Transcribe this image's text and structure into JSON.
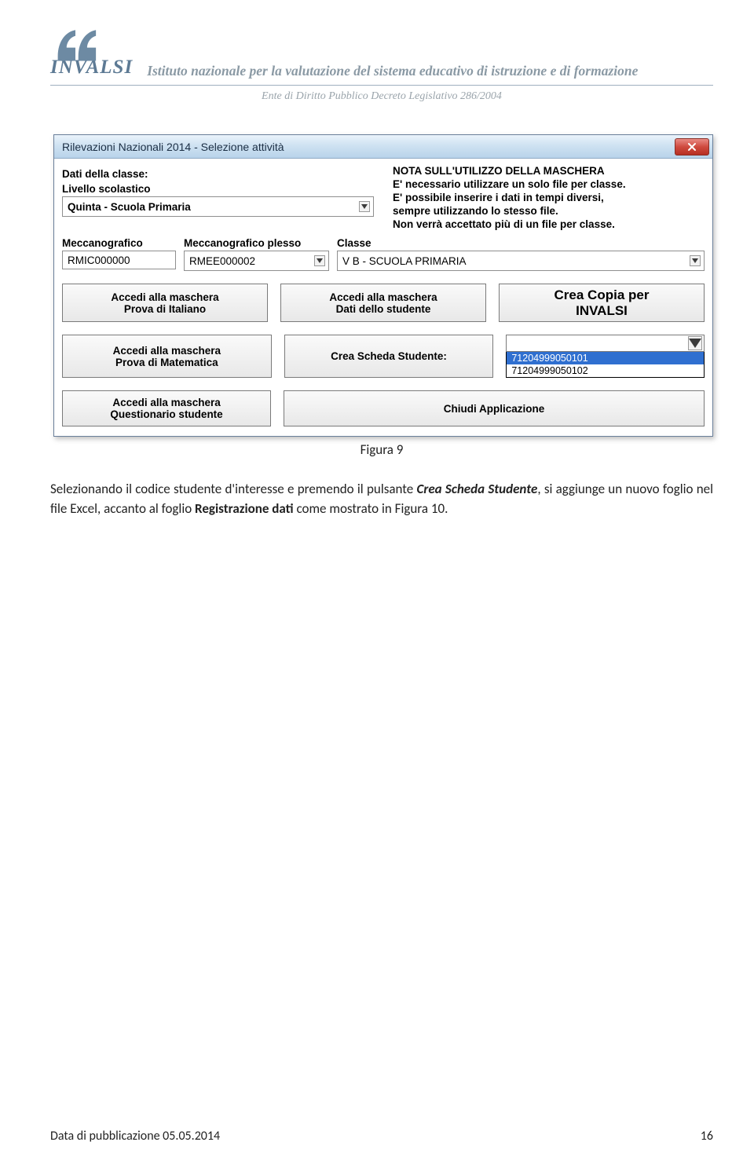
{
  "header": {
    "logo": "INVALSI",
    "tagline": "Istituto nazionale per la valutazione del sistema educativo di istruzione e di formazione",
    "subtagline": "Ente di Diritto Pubblico Decreto Legislativo 286/2004"
  },
  "window": {
    "title": "Rilevazioni Nazionali 2014 - Selezione attività",
    "labels": {
      "dati_classe": "Dati della classe:",
      "livello": "Livello scolastico",
      "meccanografico": "Meccanografico",
      "meccanografico_plesso": "Meccanografico plesso",
      "classe": "Classe"
    },
    "livello_value": "Quinta - Scuola Primaria",
    "meccanografico_value": "RMIC000000",
    "plesso_value": "RMEE000002",
    "classe_value": "V  B - SCUOLA PRIMARIA",
    "note": {
      "l1": "NOTA SULL'UTILIZZO DELLA MASCHERA",
      "l2": "E' necessario utilizzare un solo file per classe.",
      "l3": "E' possibile inserire i dati in tempi diversi,",
      "l4": "sempre utilizzando lo stesso file.",
      "l5": "Non verrà accettato più di un file per classe."
    },
    "buttons": {
      "italiano": "Accedi alla maschera\nProva di Italiano",
      "dati_studente": "Accedi alla maschera\nDati dello studente",
      "crea_copia": "Crea Copia per\nINVALSI",
      "matematica": "Accedi alla maschera\nProva di Matematica",
      "crea_scheda": "Crea Scheda Studente:",
      "questionario": "Accedi alla maschera\nQuestionario studente",
      "chiudi": "Chiudi Applicazione"
    },
    "dropdown": {
      "value": "",
      "options": [
        "71204999050101",
        "71204999050102"
      ]
    }
  },
  "figure_caption": "Figura 9",
  "body": {
    "p1_a": "Selezionando il codice studente d'interesse e premendo il pulsante ",
    "p1_b": "Crea Scheda Studente",
    "p1_c": ", si aggiunge un nuovo foglio nel file Excel, accanto al foglio ",
    "p1_d": "Registrazione dati",
    "p1_e": " come mostrato in Figura 10."
  },
  "footer": {
    "left": "Data di pubblicazione 05.05.2014",
    "right": "16"
  }
}
